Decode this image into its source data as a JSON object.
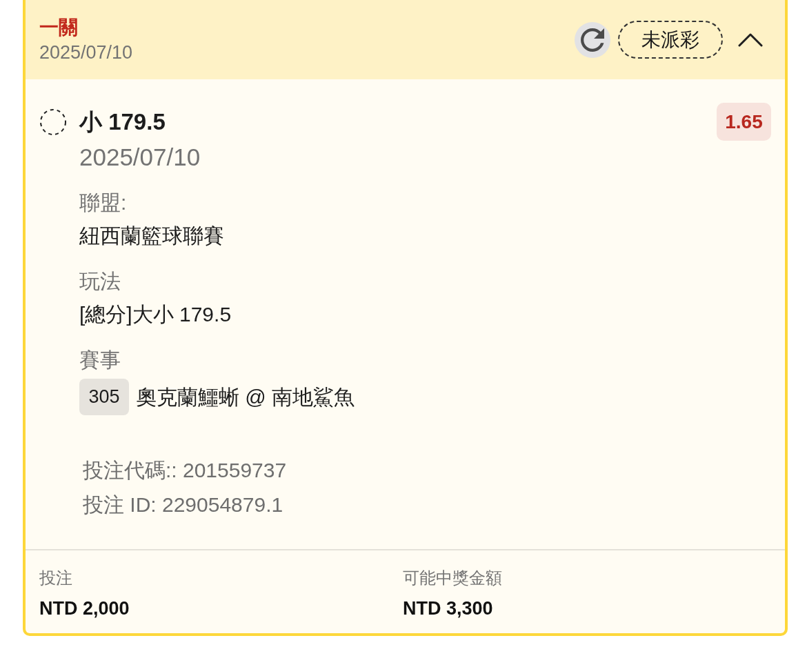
{
  "header": {
    "title": "一關",
    "date": "2025/07/10",
    "status": "未派彩",
    "expanded": true
  },
  "bet": {
    "pick": "小 179.5",
    "date": "2025/07/10",
    "odds": "1.65",
    "details": [
      {
        "kind": "text",
        "label": "聯盟:",
        "value": "紐西蘭籃球聯賽"
      },
      {
        "kind": "text",
        "label": "玩法",
        "value": "[總分]大小 179.5"
      },
      {
        "kind": "match",
        "label": "賽事",
        "code": "305",
        "value": "奧克蘭鱷蜥 @ 南地鯊魚"
      }
    ],
    "references": [
      "投注代碼:: 201559737",
      "投注 ID: 229054879.1"
    ]
  },
  "summary": [
    {
      "label": "投注",
      "value": "NTD 2,000"
    },
    {
      "label": "可能中獎金額",
      "value": "NTD 3,300"
    }
  ]
}
